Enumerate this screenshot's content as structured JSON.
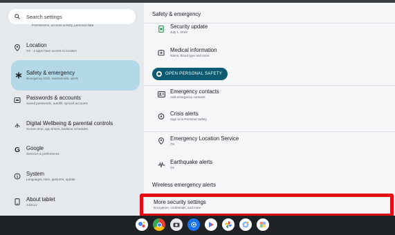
{
  "search": {
    "placeholder": "Search settings",
    "icon": "search-icon"
  },
  "left_cutoff_subtitle": "Permissions, account activity, personal data",
  "sidebar": {
    "items": [
      {
        "title": "Location",
        "subtitle": "On - 3 apps have access to location",
        "icon": "location-pin-icon"
      },
      {
        "title": "Safety & emergency",
        "subtitle": "Emergency SOS, medical info, alerts",
        "icon": "asterisk-icon",
        "active": true
      },
      {
        "title": "Passwords & accounts",
        "subtitle": "Saved passwords, autofill, synced accounts",
        "icon": "passwords-icon"
      },
      {
        "title": "Digital Wellbeing & parental controls",
        "subtitle": "Screen time, app timers, bedtime schedules",
        "icon": "wellbeing-icon"
      },
      {
        "title": "Google",
        "subtitle": "Services & preferences",
        "icon": "google-icon"
      },
      {
        "title": "System",
        "subtitle": "Languages, time, gestures, update",
        "icon": "info-icon"
      },
      {
        "title": "About tablet",
        "subtitle": "A301LV",
        "icon": "tablet-icon"
      }
    ]
  },
  "detail": {
    "title": "Safety & emergency",
    "items": [
      {
        "title": "Security update",
        "subtitle": "July 1, 2018",
        "icon": "security-update-icon"
      },
      {
        "title": "Medical information",
        "subtitle": "Name, blood type and more",
        "icon": "medical-info-icon"
      },
      {
        "title": "Emergency contacts",
        "subtitle": "Add emergency contacts",
        "icon": "contacts-icon"
      },
      {
        "title": "Crisis alerts",
        "subtitle": "Sign in to Personal Safety",
        "icon": "crisis-alerts-icon"
      },
      {
        "title": "Emergency Location Service",
        "subtitle": "On",
        "icon": "location-pin-icon"
      },
      {
        "title": "Earthquake alerts",
        "subtitle": "On",
        "icon": "earthquake-icon"
      }
    ],
    "personal_safety_button": "OPEN PERSONAL SAFETY",
    "wireless_label": "Wireless emergency alerts",
    "more_security": {
      "title": "More security settings",
      "subtitle": "Encryption, credentials, and more"
    }
  },
  "colors": {
    "active_item": "#b3d9e8",
    "pill": "#0c5b73",
    "highlight": "#e40d14",
    "dock": "#1f2326"
  },
  "dock": {
    "apps": [
      {
        "name": "assistant-app-icon",
        "color": "#4285f4"
      },
      {
        "name": "chrome-app-icon",
        "color": "#fbbc05"
      },
      {
        "name": "camera-app-icon",
        "color": "#e8eaed"
      },
      {
        "name": "settings-app-icon",
        "color": "#1a73e8"
      },
      {
        "name": "play-app-icon",
        "color": "#ea4335"
      },
      {
        "name": "photos-app-icon",
        "color": "#34a853"
      },
      {
        "name": "files-app-icon",
        "color": "#8ab4f8"
      },
      {
        "name": "game-app-icon",
        "color": "#f28b82"
      }
    ]
  }
}
